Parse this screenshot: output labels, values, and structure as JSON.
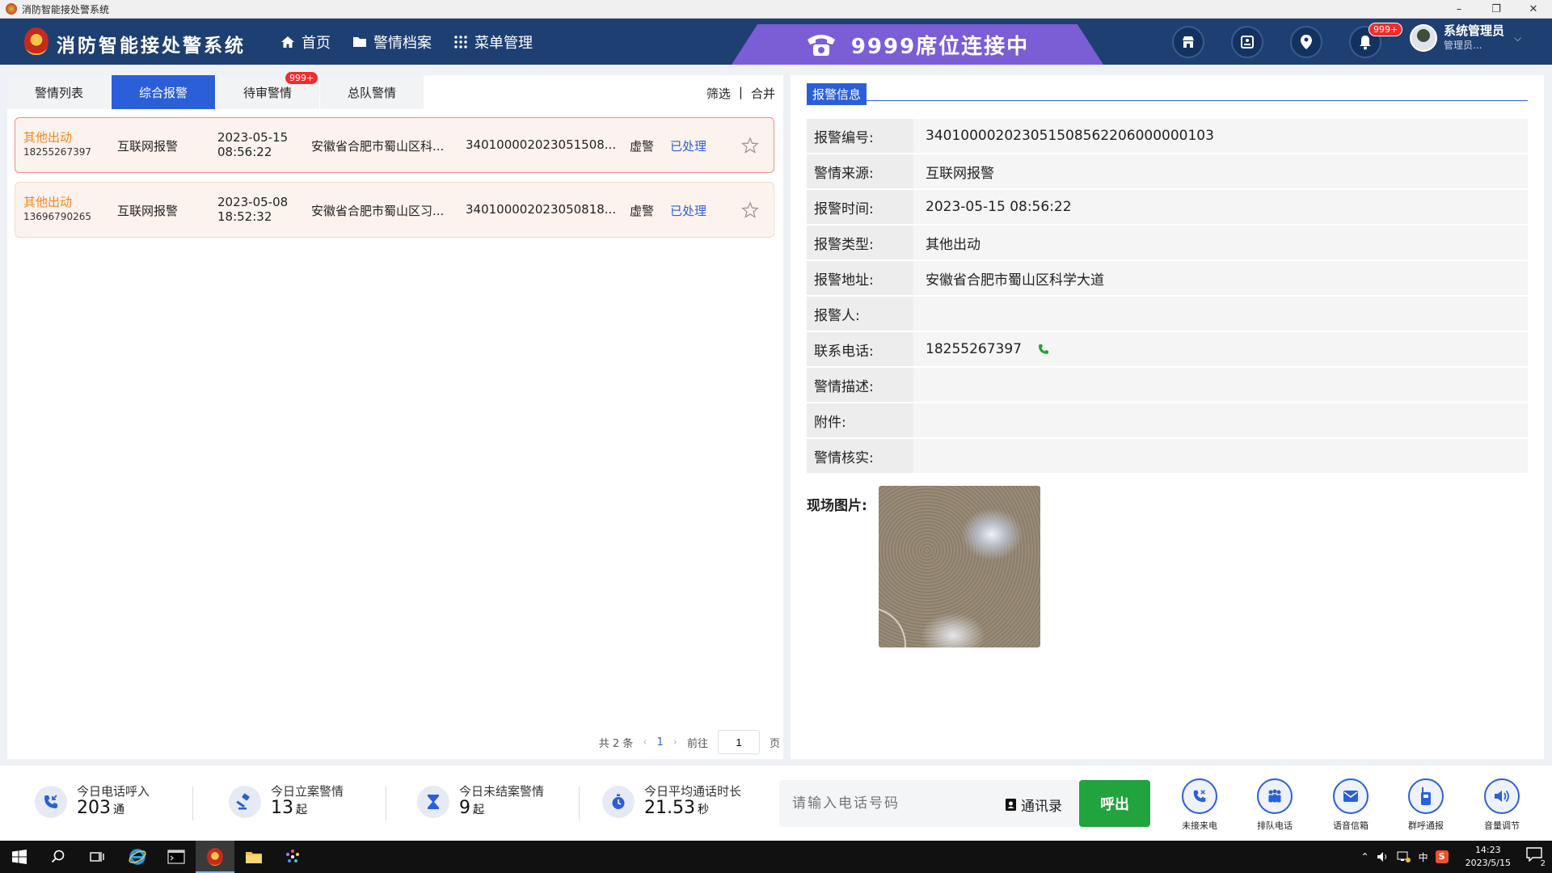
{
  "window": {
    "title": "消防智能接处警系统",
    "controls": [
      "–",
      "❐",
      "✕"
    ]
  },
  "header": {
    "app_title": "消防智能接处警系统",
    "nav": [
      {
        "label": "首页",
        "icon": "home-icon"
      },
      {
        "label": "警情档案",
        "icon": "folder-icon"
      },
      {
        "label": "菜单管理",
        "icon": "grid-icon"
      }
    ],
    "seat_banner": "9999席位连接中",
    "icons": [
      "shop-icon",
      "id-card-icon",
      "location-user-icon",
      "bell-icon"
    ],
    "bell_badge": "999+",
    "user": {
      "name": "系统管理员",
      "role": "管理员..."
    }
  },
  "left": {
    "tabs": [
      {
        "label": "警情列表"
      },
      {
        "label": "综合报警",
        "active": true
      },
      {
        "label": "待审警情",
        "badge": "999+"
      },
      {
        "label": "总队警情"
      }
    ],
    "tools": {
      "filter": "筛选",
      "sep": "|",
      "merge": "合并"
    },
    "rows": [
      {
        "type": "其他出动",
        "phone": "18255267397",
        "source": "互联网报警",
        "date": "2023-05-15",
        "time": "08:56:22",
        "address": "安徽省合肥市蜀山区科...",
        "code": "340100002023051508...",
        "nature": "虚警",
        "status": "已处理"
      },
      {
        "type": "其他出动",
        "phone": "13696790265",
        "source": "互联网报警",
        "date": "2023-05-08",
        "time": "18:52:32",
        "address": "安徽省合肥市蜀山区习...",
        "code": "340100002023050818...",
        "nature": "虚警",
        "status": "已处理"
      }
    ],
    "pager": {
      "total": "共 2 条",
      "prev": "‹",
      "current": "1",
      "next": "›",
      "goto_label": "前往",
      "goto_value": "1",
      "page_unit": "页"
    }
  },
  "right": {
    "section_title": "报警信息",
    "fields": [
      {
        "label": "报警编号:",
        "value": "340100002023051508562206000000103"
      },
      {
        "label": "警情来源:",
        "value": "互联网报警"
      },
      {
        "label": "报警时间:",
        "value": "2023-05-15 08:56:22"
      },
      {
        "label": "报警类型:",
        "value": "其他出动"
      },
      {
        "label": "报警地址:",
        "value": "安徽省合肥市蜀山区科学大道"
      },
      {
        "label": "报警人:",
        "value": ""
      },
      {
        "label": "联系电话:",
        "value": "18255267397"
      },
      {
        "label": "警情描述:",
        "value": ""
      },
      {
        "label": "附件:",
        "value": ""
      },
      {
        "label": "警情核实:",
        "value": ""
      }
    ],
    "photo_label": "现场图片:"
  },
  "stats": [
    {
      "label": "今日电话呼入",
      "value": "203",
      "unit": "通",
      "icon": "incoming-call-icon"
    },
    {
      "label": "今日立案警情",
      "value": "13",
      "unit": "起",
      "icon": "gavel-icon"
    },
    {
      "label": "今日未结案警情",
      "value": "9",
      "unit": "起",
      "icon": "hourglass-icon"
    },
    {
      "label": "今日平均通话时长",
      "value": "21.53",
      "unit": "秒",
      "icon": "stopwatch-icon"
    }
  ],
  "dial": {
    "placeholder": "请输入电话号码",
    "contacts": "通讯录",
    "call": "呼出"
  },
  "tools": [
    {
      "label": "未接来电",
      "icon": "missed-call-icon"
    },
    {
      "label": "排队电话",
      "icon": "queue-people-icon"
    },
    {
      "label": "语音信箱",
      "icon": "mail-icon"
    },
    {
      "label": "群呼通报",
      "icon": "walkie-talkie-icon"
    },
    {
      "label": "音量调节",
      "icon": "volume-icon"
    }
  ],
  "taskbar": {
    "tray": {
      "ime": "中",
      "time": "14:23",
      "date": "2023/5/15",
      "notifications": "2"
    }
  },
  "colors": {
    "header_bg": "#1e3f72",
    "primary": "#2b5fd9",
    "banner": "#7b5ed6",
    "call_green": "#21a33e",
    "badge_red": "#f22b2b",
    "alarm_type_orange": "#f3841b"
  }
}
